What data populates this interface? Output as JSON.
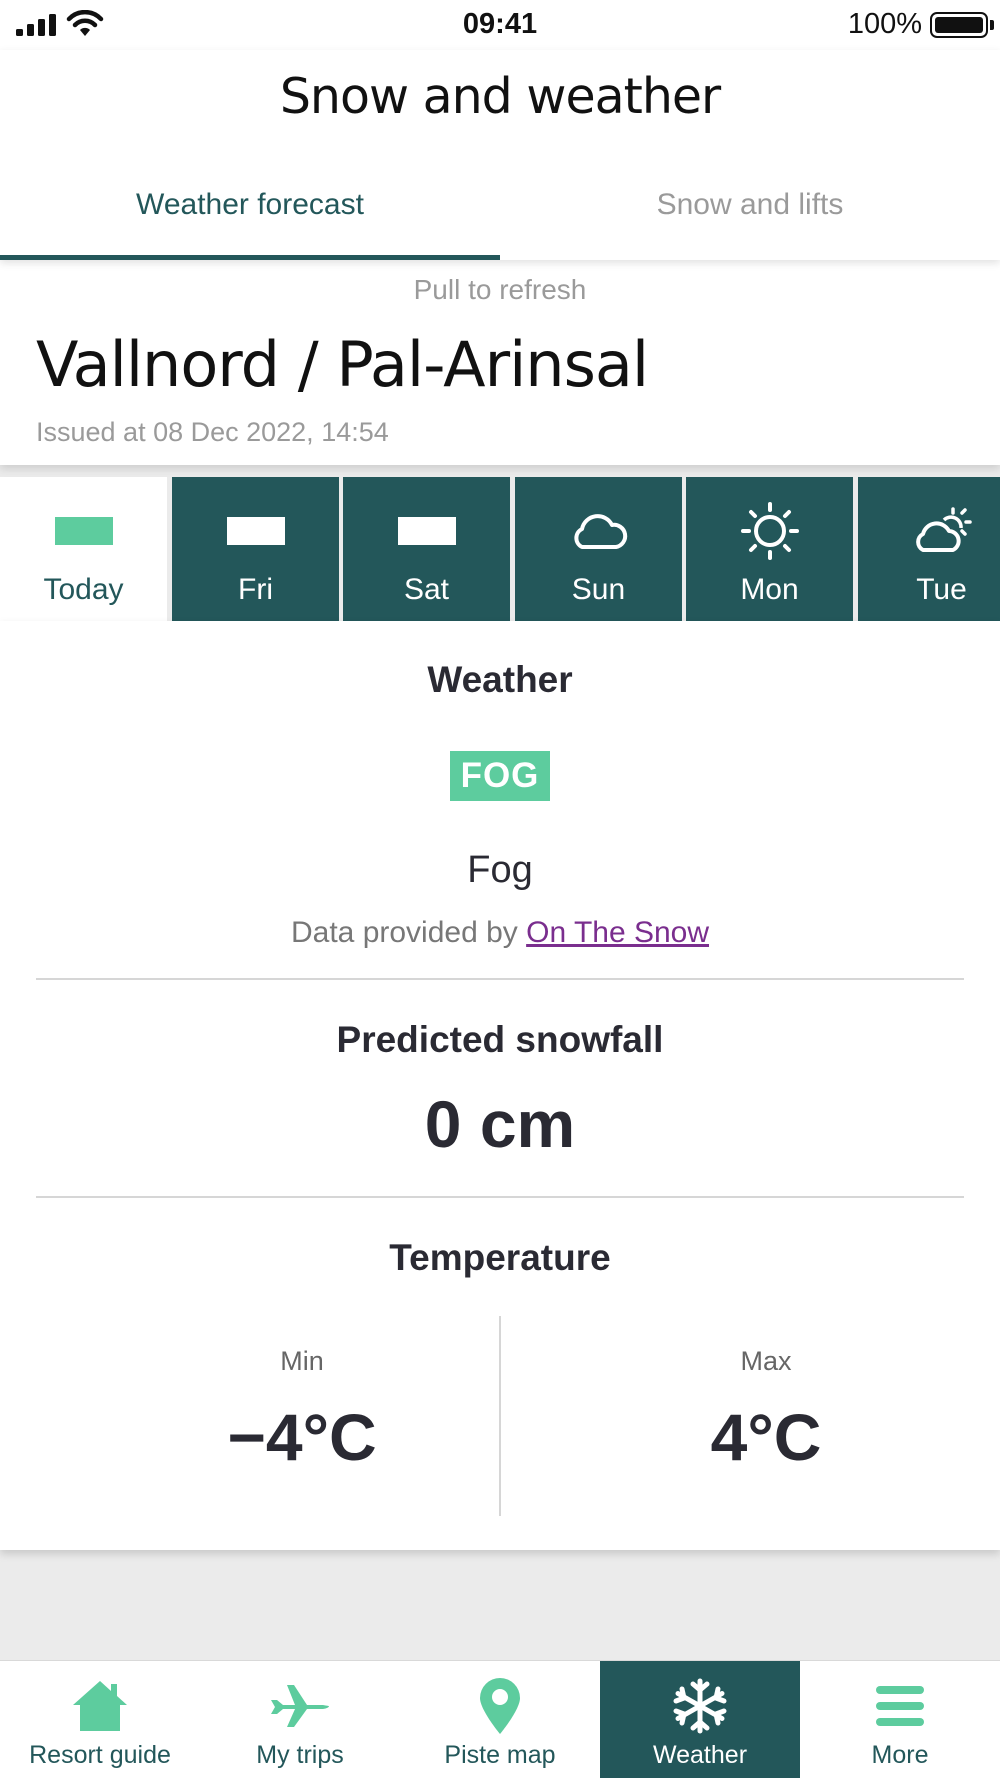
{
  "status": {
    "time": "09:41",
    "battery": "100%"
  },
  "header": {
    "title": "Snow and weather",
    "tabs": [
      {
        "label": "Weather forecast",
        "active": true
      },
      {
        "label": "Snow and lifts",
        "active": false
      }
    ]
  },
  "resort": {
    "pull_to_refresh": "Pull to refresh",
    "name": "Vallnord / Pal-Arinsal",
    "issued": "Issued at 08 Dec 2022, 14:54"
  },
  "days": [
    {
      "label": "Today",
      "icon": "fog-icon",
      "selected": true
    },
    {
      "label": "Fri",
      "icon": "fog-icon",
      "selected": false
    },
    {
      "label": "Sat",
      "icon": "fog-icon",
      "selected": false
    },
    {
      "label": "Sun",
      "icon": "cloud-icon",
      "selected": false
    },
    {
      "label": "Mon",
      "icon": "sun-icon",
      "selected": false
    },
    {
      "label": "Tue",
      "icon": "partly-cloudy-icon",
      "selected": false
    }
  ],
  "weather": {
    "title": "Weather",
    "badge": "FOG",
    "condition": "Fog",
    "provider_prefix": "Data provided by ",
    "provider_link": "On The Snow"
  },
  "snowfall": {
    "title": "Predicted snowfall",
    "value": "0 cm"
  },
  "temperature": {
    "title": "Temperature",
    "min_label": "Min",
    "min_value": "−4°C",
    "max_label": "Max",
    "max_value": "4°C"
  },
  "tabbar": [
    {
      "label": "Resort guide",
      "icon": "home-icon",
      "active": false
    },
    {
      "label": "My trips",
      "icon": "plane-icon",
      "active": false
    },
    {
      "label": "Piste map",
      "icon": "map-pin-icon",
      "active": false
    },
    {
      "label": "Weather",
      "icon": "snowflake-icon",
      "active": true
    },
    {
      "label": "More",
      "icon": "menu-icon",
      "active": false
    }
  ],
  "colors": {
    "primary": "#23575a",
    "accent": "#5dcc9e",
    "link": "#7a2e8e"
  }
}
